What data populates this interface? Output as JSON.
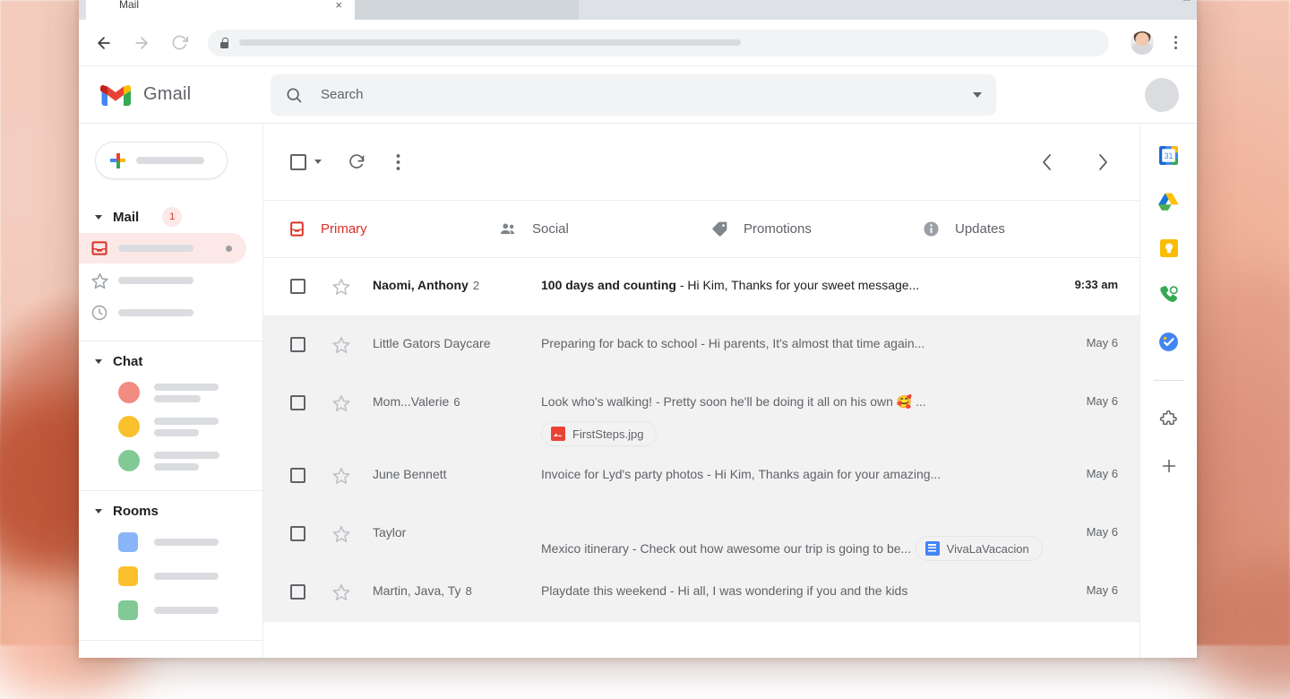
{
  "browser": {
    "tabs": [
      {
        "title": "Mail",
        "favicon": "gmail-favicon",
        "active": true,
        "close_label": "×"
      },
      {
        "title": "",
        "favicon": "page-favicon",
        "active": false,
        "close_label": ""
      }
    ],
    "nav": {
      "back": "←",
      "forward": "→",
      "reload": "⟳"
    },
    "omnibox": {
      "value": "",
      "lock_icon": "lock-icon"
    },
    "profile_avatar": "chrome-profile-avatar",
    "menu": "chrome-menu-icon"
  },
  "gmail": {
    "brand": {
      "logo": "gmail-logo",
      "name": "Gmail"
    },
    "search": {
      "placeholder": "Search",
      "icon": "search-icon",
      "options_icon": "show-search-options-icon"
    },
    "account_avatar": "google-account-avatar"
  },
  "sidebar": {
    "compose": {
      "icon": "compose-plus-icon",
      "label": ""
    },
    "sections": [
      {
        "title": "Mail",
        "badge": "1",
        "items": [
          {
            "icon": "inbox-icon",
            "label": "",
            "active": true,
            "has_dot": true
          },
          {
            "icon": "star-icon",
            "label": "",
            "active": false,
            "has_dot": false
          },
          {
            "icon": "snooze-clock-icon",
            "label": "",
            "active": false,
            "has_dot": false
          }
        ]
      },
      {
        "title": "Chat",
        "badge": "",
        "contacts": [
          {
            "avatar_color": "#f28b82",
            "avatar_shape": "circle"
          },
          {
            "avatar_color": "#fbc02d",
            "avatar_shape": "circle"
          },
          {
            "avatar_color": "#81c995",
            "avatar_shape": "circle"
          }
        ]
      },
      {
        "title": "Rooms",
        "badge": "",
        "contacts": [
          {
            "avatar_color": "#8ab4f8",
            "avatar_shape": "square"
          },
          {
            "avatar_color": "#fbc02d",
            "avatar_shape": "square"
          },
          {
            "avatar_color": "#81c995",
            "avatar_shape": "square"
          }
        ]
      }
    ]
  },
  "toolbar": {
    "select_all": "select-all-checkbox",
    "select_dropdown": "select-dropdown-caret",
    "refresh": "refresh-icon",
    "more": "more-options-icon",
    "prev_page": "‹",
    "next_page": "›"
  },
  "category_tabs": [
    {
      "label": "Primary",
      "icon": "inbox-tab-icon",
      "active": true,
      "color": "#d93025"
    },
    {
      "label": "Social",
      "icon": "people-icon",
      "active": false,
      "color": "#5f6368"
    },
    {
      "label": "Promotions",
      "icon": "tag-icon",
      "active": false,
      "color": "#5f6368"
    },
    {
      "label": "Updates",
      "icon": "info-icon",
      "active": false,
      "color": "#5f6368"
    }
  ],
  "emails": [
    {
      "unread": true,
      "sender": "Naomi, Anthony",
      "count": "2",
      "subject": "100 days and counting",
      "snippet": " - Hi Kim, Thanks for your sweet message...",
      "time": "9:33 am",
      "attachment": null
    },
    {
      "unread": false,
      "sender": "Little Gators Daycare",
      "count": "",
      "subject": "Preparing for back to school",
      "snippet": " - Hi parents, It's almost that time again...",
      "time": "May 6",
      "attachment": null
    },
    {
      "unread": false,
      "sender": "Mom...Valerie",
      "count": "6",
      "subject": "Look who's walking!",
      "snippet": " - Pretty soon he'll be doing it all on his own 🥰 ...",
      "time": "May 6",
      "attachment": {
        "name": "FirstSteps.jpg",
        "type": "image"
      }
    },
    {
      "unread": false,
      "sender": "June Bennett",
      "count": "",
      "subject": "Invoice for Lyd's party photos",
      "snippet": " - Hi Kim, Thanks again for your amazing...",
      "time": "May 6",
      "attachment": null
    },
    {
      "unread": false,
      "sender": "Taylor",
      "count": "",
      "subject": "Mexico itinerary",
      "snippet": " - Check out how awesome our trip is going to be...",
      "time": "May 6",
      "attachment": {
        "name": "VivaLaVacacion",
        "type": "doc"
      }
    },
    {
      "unread": false,
      "sender": "Martin, Java, Ty",
      "count": "8",
      "subject": "Playdate this weekend",
      "snippet": " - Hi all, I was wondering if you and the kids",
      "time": "May 6",
      "attachment": null
    }
  ],
  "side_panel": {
    "apps": [
      {
        "name": "google-calendar-icon",
        "day": "31"
      },
      {
        "name": "google-drive-icon"
      },
      {
        "name": "google-keep-icon"
      },
      {
        "name": "google-voice-icon"
      },
      {
        "name": "google-tasks-icon"
      }
    ],
    "addons": {
      "marketplace": "get-addons-puzzle-icon",
      "add": "+"
    }
  }
}
